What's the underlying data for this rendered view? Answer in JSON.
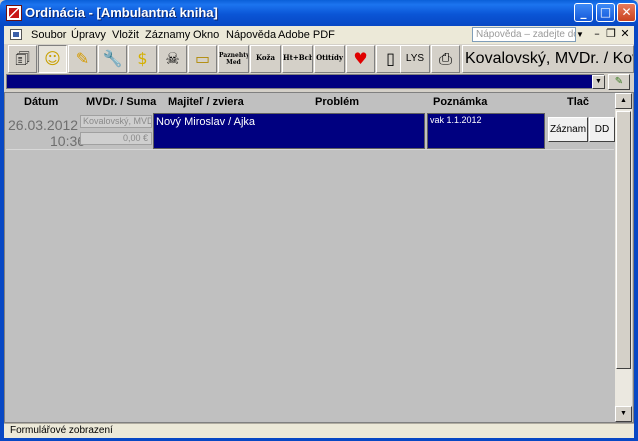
{
  "window": {
    "title": "Ordinácia - [Ambulantná kniha]"
  },
  "menu": {
    "items": [
      "Soubor",
      "Úpravy",
      "Vložit",
      "Záznamy",
      "Okno",
      "Nápověda",
      "Adobe PDF"
    ],
    "help_placeholder": "Nápověda – zadejte dotaz"
  },
  "toolbar": {
    "buttons": {
      "pazneht": "Paznehty Med",
      "koza": "Koža",
      "htbch": "Ht+Bch",
      "otitidy": "Otitídy",
      "lys": "LYS"
    },
    "doctor": "Kovalovský, MVDr. / Kovalovský"
  },
  "table": {
    "headers": [
      "Dátum",
      "MVDr. / Suma",
      "Majiteľ / zviera",
      "Problém",
      "Poznámka",
      "Tlač"
    ]
  },
  "record": {
    "date": "26.03.2012",
    "time": "10:36",
    "vet": "Kovalovský, MVD",
    "sum": "0,00 €",
    "owner": "Nový Miroslav /  Ajka",
    "note": "vak 1.1.2012",
    "buttons": {
      "zaznam": "Záznam",
      "dd": "DD"
    }
  },
  "status": {
    "text": "Formulářové zobrazení"
  },
  "colors": {
    "titlebar": "#0a55d6",
    "selection": "#000080",
    "background": "#c0c0c0"
  }
}
